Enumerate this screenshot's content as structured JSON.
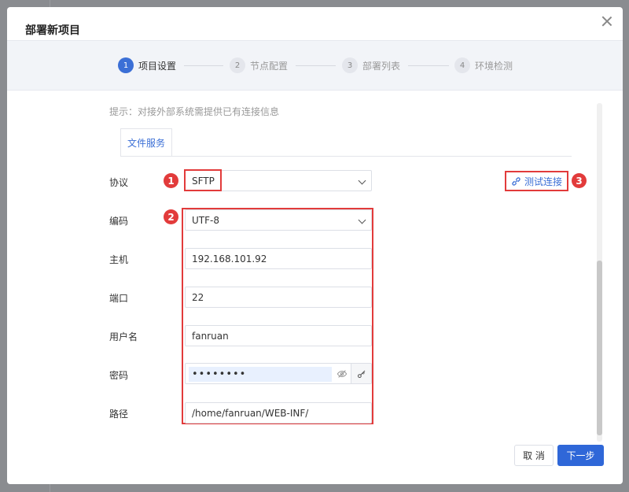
{
  "dialog": {
    "title": "部署新项目",
    "close_icon": "close-icon"
  },
  "steps": [
    {
      "num": "1",
      "label": "项目设置",
      "active": true
    },
    {
      "num": "2",
      "label": "节点配置",
      "active": false
    },
    {
      "num": "3",
      "label": "部署列表",
      "active": false
    },
    {
      "num": "4",
      "label": "环境检测",
      "active": false
    }
  ],
  "hint": "提示：对接外部系统需提供已有连接信息",
  "tab": "文件服务",
  "form": {
    "protocol_label": "协议",
    "protocol_value": "SFTP",
    "encoding_label": "编码",
    "encoding_value": "UTF-8",
    "host_label": "主机",
    "host_value": "192.168.101.92",
    "port_label": "端口",
    "port_value": "22",
    "user_label": "用户名",
    "user_value": "fanruan",
    "password_label": "密码",
    "password_value": "••••••••",
    "path_label": "路径",
    "path_value": "/home/fanruan/WEB-INF/"
  },
  "test_button": "测试连接",
  "badges": [
    "1",
    "2",
    "3"
  ],
  "buttons": {
    "cancel": "取 消",
    "next": "下一步"
  },
  "colors": {
    "accent": "#2f67d8",
    "highlight": "#e23b3b"
  }
}
